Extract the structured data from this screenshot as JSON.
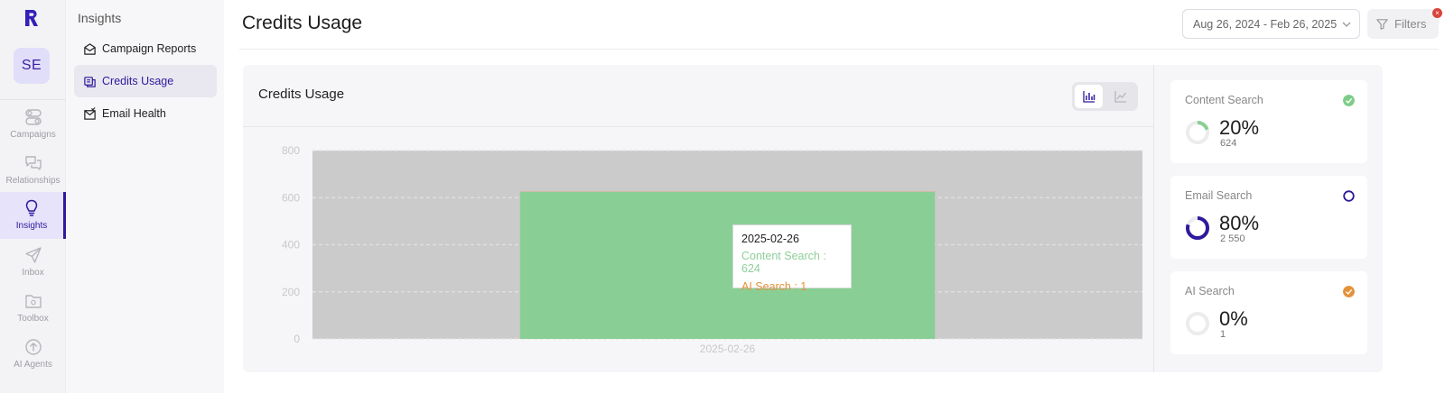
{
  "app": {
    "logo_letter": "R"
  },
  "user": {
    "initials": "SE"
  },
  "rail": [
    {
      "label": "Campaigns",
      "icon": "toggle-icon"
    },
    {
      "label": "Relationships",
      "icon": "chat-icon"
    },
    {
      "label": "Insights",
      "icon": "lightbulb-icon",
      "active": true
    },
    {
      "label": "Inbox",
      "icon": "send-icon"
    },
    {
      "label": "Toolbox",
      "icon": "folder-icon"
    },
    {
      "label": "AI Agents",
      "icon": "upload-circle-icon"
    }
  ],
  "subnav": {
    "title": "Insights",
    "items": [
      {
        "label": "Campaign Reports",
        "icon": "mail-open-icon"
      },
      {
        "label": "Credits Usage",
        "icon": "coins-icon",
        "active": true
      },
      {
        "label": "Email Health",
        "icon": "mail-check-icon"
      }
    ]
  },
  "header": {
    "title": "Credits Usage",
    "date_range": "Aug 26, 2024 - Feb 26, 2025",
    "filters_label": "Filters",
    "filter_badge": "×"
  },
  "card": {
    "title": "Credits Usage",
    "view_toggle": [
      "bar-chart-icon",
      "line-chart-icon"
    ]
  },
  "tooltip": {
    "date": "2025-02-26",
    "content_line": "Content Search : 624",
    "ai_line": "AI Search : 1"
  },
  "chart_data": {
    "type": "bar",
    "categories": [
      "2025-02-26"
    ],
    "ylim": [
      0,
      800
    ],
    "yticks": [
      0,
      200,
      400,
      600,
      800
    ],
    "series": [
      {
        "name": "Content Search",
        "values": [
          624
        ],
        "color": "#89cf95"
      },
      {
        "name": "AI Search",
        "values": [
          1
        ],
        "color": "#e4923a"
      }
    ],
    "hover_band_color": "#cbcbcb",
    "hovered_category": "2025-02-26"
  },
  "stats": [
    {
      "label": "Content Search",
      "percent": "20%",
      "count": "624",
      "fraction": 0.2,
      "ring_color": "#89cf95",
      "status_color": "#7fcc8a",
      "status": "check"
    },
    {
      "label": "Email Search",
      "percent": "80%",
      "count": "2 550",
      "fraction": 0.8,
      "ring_color": "#2e1a9c",
      "status_color": "#2e1a9c",
      "status": "circle"
    },
    {
      "label": "AI Search",
      "percent": "0%",
      "count": "1",
      "fraction": 0.0,
      "ring_color": "#e4923a",
      "status_color": "#e4923a",
      "status": "check"
    }
  ]
}
